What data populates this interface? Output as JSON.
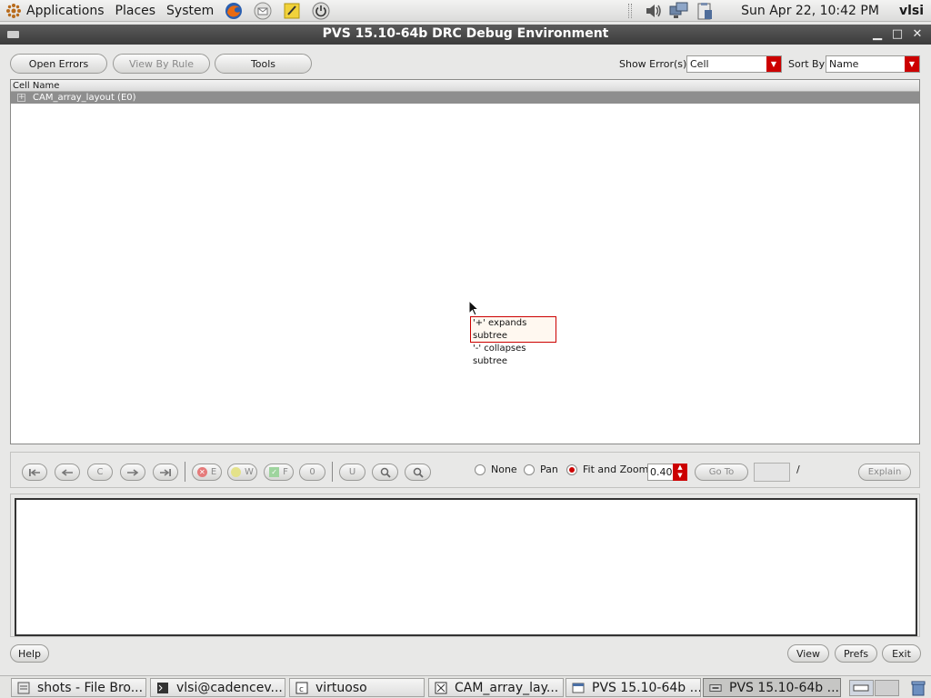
{
  "panel": {
    "menus": [
      "Applications",
      "Places",
      "System"
    ],
    "clock": "Sun Apr 22, 10:42 PM",
    "user": "vlsi"
  },
  "window": {
    "title": "PVS 15.10-64b DRC Debug Environment"
  },
  "toolbar": {
    "open_errors": "Open Errors",
    "view_by_rule": "View By Rule",
    "tools": "Tools",
    "show_errors_label": "Show Error(s)",
    "show_errors_value": "Cell",
    "sort_by_label": "Sort By",
    "sort_by_value": "Name"
  },
  "tree": {
    "header": "Cell Name",
    "expander": "+",
    "rows": [
      {
        "label": "CAM_array_layout (E0)"
      }
    ]
  },
  "tooltip": {
    "line1": "'+' expands subtree",
    "line2": "'-' collapses subtree"
  },
  "nav": {
    "buttons": [
      {
        "name": "first-icon-button",
        "label": ""
      },
      {
        "name": "prev-icon-button",
        "label": ""
      },
      {
        "name": "current-button",
        "label": "C"
      },
      {
        "name": "next-icon-button",
        "label": ""
      },
      {
        "name": "last-icon-button",
        "label": ""
      },
      {
        "name": "errors-button",
        "label": "E"
      },
      {
        "name": "warnings-button",
        "label": "W"
      },
      {
        "name": "fixed-button",
        "label": "F"
      },
      {
        "name": "zero-button",
        "label": "0"
      },
      {
        "name": "undo-button",
        "label": "U"
      }
    ],
    "mode_none": "None",
    "mode_pan": "Pan",
    "mode_fit_zoom": "Fit and Zoom",
    "zoom_value": "0.40",
    "goto": "Go To",
    "page_separator": "/",
    "explain": "Explain"
  },
  "bottom": {
    "help": "Help",
    "view": "View",
    "prefs": "Prefs",
    "exit": "Exit"
  },
  "taskbar": {
    "tasks": [
      {
        "label": "shots - File Bro..."
      },
      {
        "label": "vlsi@cadencev..."
      },
      {
        "label": "virtuoso"
      },
      {
        "label": "CAM_array_lay..."
      },
      {
        "label": "PVS 15.10-64b ..."
      },
      {
        "label": "PVS 15.10-64b ..."
      }
    ]
  },
  "colors": {
    "accent": "#cc0000",
    "title_bar": "#4a4a4a",
    "selected_row": "#8e8e8e"
  }
}
